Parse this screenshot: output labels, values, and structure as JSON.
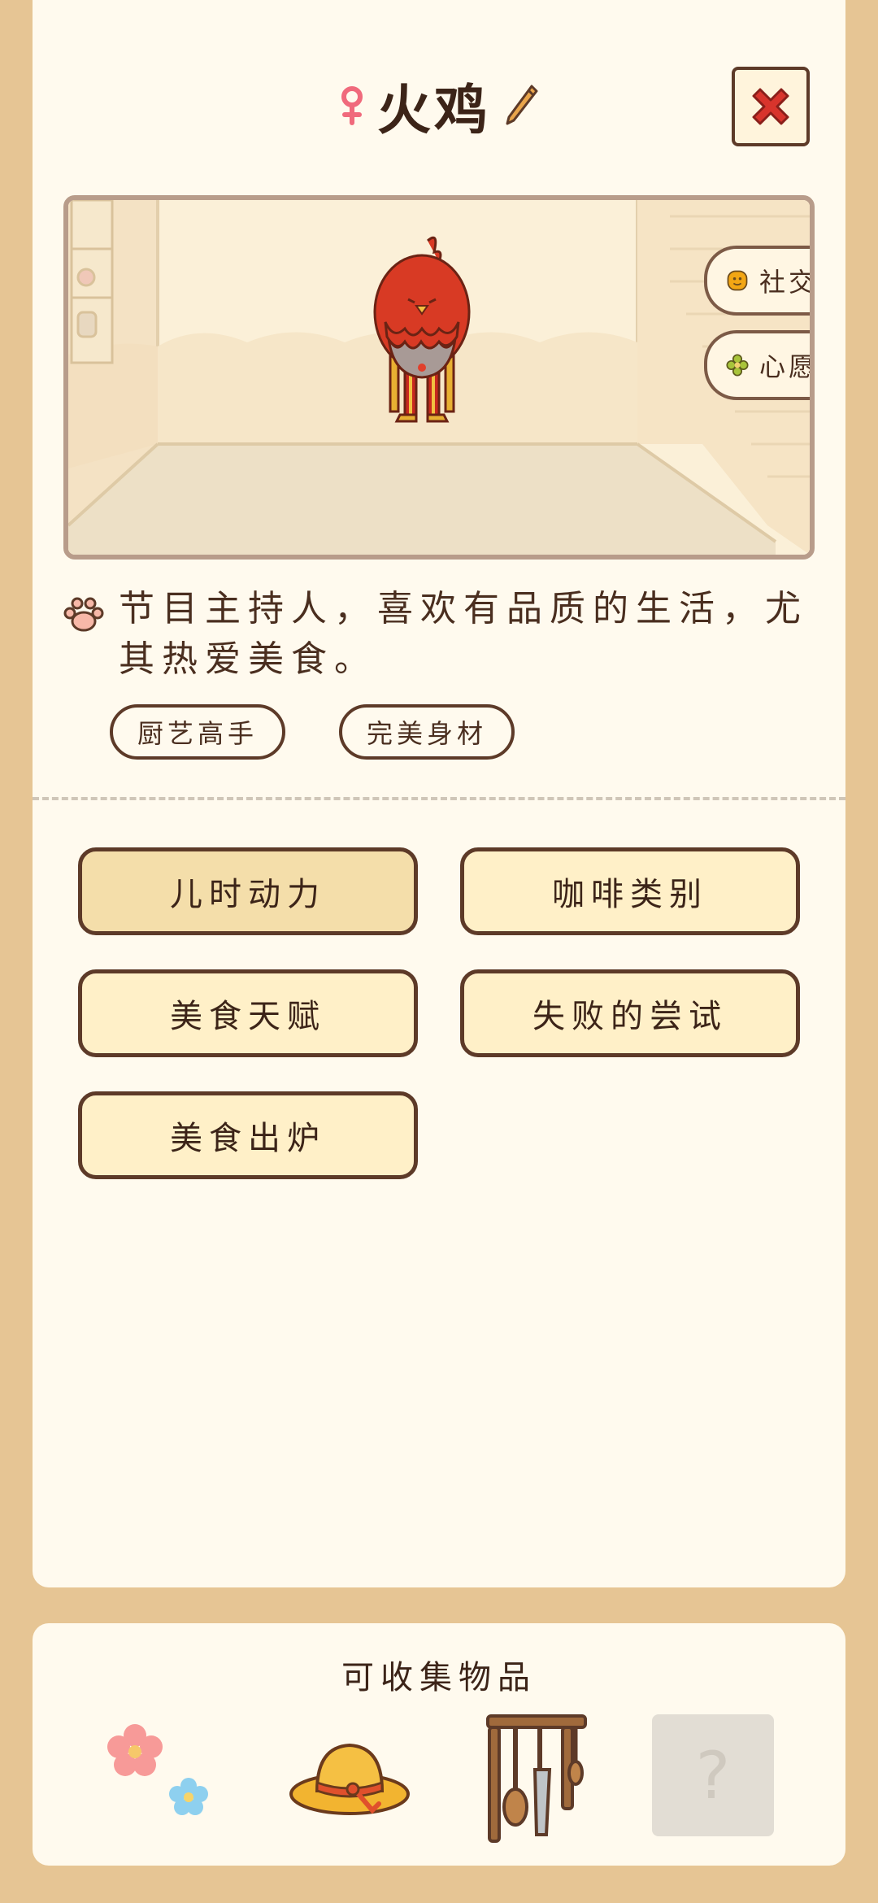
{
  "character": {
    "name": "火鸡",
    "gender_icon": "female-icon",
    "description": "节目主持人，喜欢有品质的生活，尤其热爱美食。",
    "tags": [
      "厨艺高手",
      "完美身材"
    ]
  },
  "side_buttons": {
    "social": "社交",
    "wish": "心愿"
  },
  "stories": [
    {
      "label": "儿时动力",
      "active": true
    },
    {
      "label": "咖啡类别",
      "active": false
    },
    {
      "label": "美食天赋",
      "active": false
    },
    {
      "label": "失败的尝试",
      "active": false
    },
    {
      "label": "美食出炉",
      "active": false
    }
  ],
  "collectibles": {
    "title": "可收集物品",
    "items": [
      "flower-icon",
      "straw-hat-icon",
      "kitchen-utensil-rack-icon"
    ],
    "locked_placeholder": "?"
  },
  "colors": {
    "background": "#e6c594",
    "card": "#fffaee",
    "outline": "#5d3a28",
    "button_fill": "#fff0c8",
    "close_x": "#d8342c"
  }
}
